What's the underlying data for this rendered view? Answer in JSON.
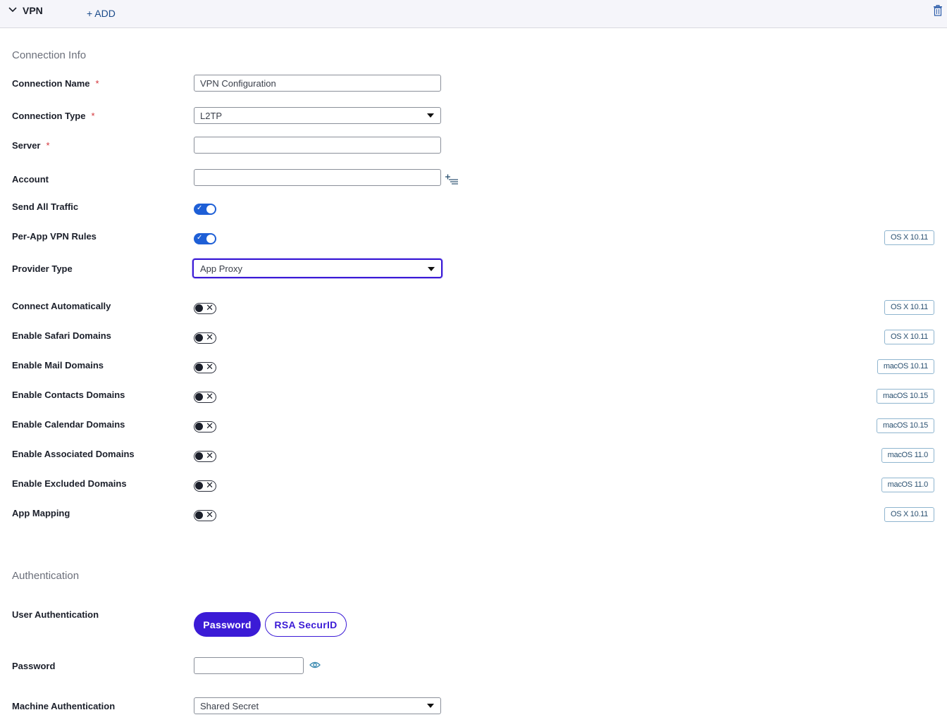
{
  "header": {
    "title": "VPN",
    "add_label": "+ ADD"
  },
  "sections": {
    "connection_info": "Connection Info",
    "authentication": "Authentication"
  },
  "fields": {
    "connection_name": {
      "label": "Connection Name",
      "required": "*",
      "value": "VPN Configuration"
    },
    "connection_type": {
      "label": "Connection Type",
      "required": "*",
      "value": "L2TP"
    },
    "server": {
      "label": "Server",
      "required": "*",
      "value": ""
    },
    "account": {
      "label": "Account",
      "value": ""
    },
    "send_all_traffic": {
      "label": "Send All Traffic",
      "state": "on"
    },
    "per_app_vpn_rules": {
      "label": "Per-App VPN Rules",
      "state": "on",
      "badge": "OS X 10.11"
    },
    "provider_type": {
      "label": "Provider Type",
      "value": "App Proxy"
    },
    "connect_automatically": {
      "label": "Connect Automatically",
      "state": "off",
      "badge": "OS X 10.11"
    },
    "enable_safari_domains": {
      "label": "Enable Safari Domains",
      "state": "off",
      "badge": "OS X 10.11"
    },
    "enable_mail_domains": {
      "label": "Enable Mail Domains",
      "state": "off",
      "badge": "macOS 10.11"
    },
    "enable_contacts_domains": {
      "label": "Enable Contacts Domains",
      "state": "off",
      "badge": "macOS 10.15"
    },
    "enable_calendar_domains": {
      "label": "Enable Calendar Domains",
      "state": "off",
      "badge": "macOS 10.15"
    },
    "enable_associated_domains": {
      "label": "Enable Associated Domains",
      "state": "off",
      "badge": "macOS 11.0"
    },
    "enable_excluded_domains": {
      "label": "Enable Excluded Domains",
      "state": "off",
      "badge": "macOS 11.0"
    },
    "app_mapping": {
      "label": "App Mapping",
      "state": "off",
      "badge": "OS X 10.11"
    },
    "user_authentication": {
      "label": "User Authentication",
      "options": [
        "Password",
        "RSA SecurID"
      ],
      "selected": "Password"
    },
    "password": {
      "label": "Password",
      "value": ""
    },
    "machine_authentication": {
      "label": "Machine Authentication",
      "value": "Shared Secret"
    }
  },
  "toggle_marks": {
    "on": "✓",
    "off": "✕"
  },
  "icons": [
    "chevron-down-icon",
    "trash-icon",
    "add-list-icon",
    "eye-icon",
    "caret-down-icon"
  ],
  "colors": {
    "primary": "#3b1bd6",
    "toggle_on": "#1e5fd6",
    "required": "#d4343a",
    "badge_border": "#8fb5cf"
  }
}
